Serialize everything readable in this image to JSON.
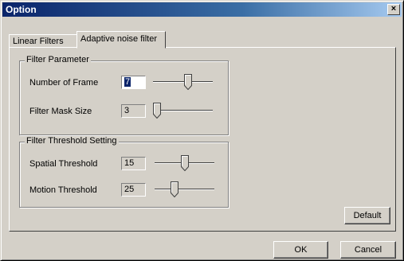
{
  "window": {
    "title": "Option",
    "close_glyph": "×"
  },
  "tabs": [
    {
      "label": "Linear Filters",
      "active": false
    },
    {
      "label": "Adaptive noise filter",
      "active": true
    }
  ],
  "filter_parameter": {
    "title": "Filter Parameter",
    "rows": [
      {
        "label": "Number of Frame",
        "value": "7",
        "slider_fraction": 0.6,
        "focused": true
      },
      {
        "label": "Filter Mask Size",
        "value": "3",
        "slider_fraction": 0.0,
        "focused": false
      }
    ]
  },
  "filter_threshold": {
    "title": "Filter Threshold Setting",
    "rows": [
      {
        "label": "Spatial Threshold",
        "value": "15",
        "slider_fraction": 0.5
      },
      {
        "label": "Motion Threshold",
        "value": "25",
        "slider_fraction": 0.3
      }
    ]
  },
  "buttons": {
    "default": "Default",
    "ok": "OK",
    "cancel": "Cancel"
  },
  "colors": {
    "face": "#d4d0c8",
    "title_start": "#0a246a",
    "title_end": "#a6caf0",
    "selection": "#0a246a"
  },
  "icons": {
    "close": "close-icon",
    "slider_thumb": "slider-thumb-icon"
  }
}
